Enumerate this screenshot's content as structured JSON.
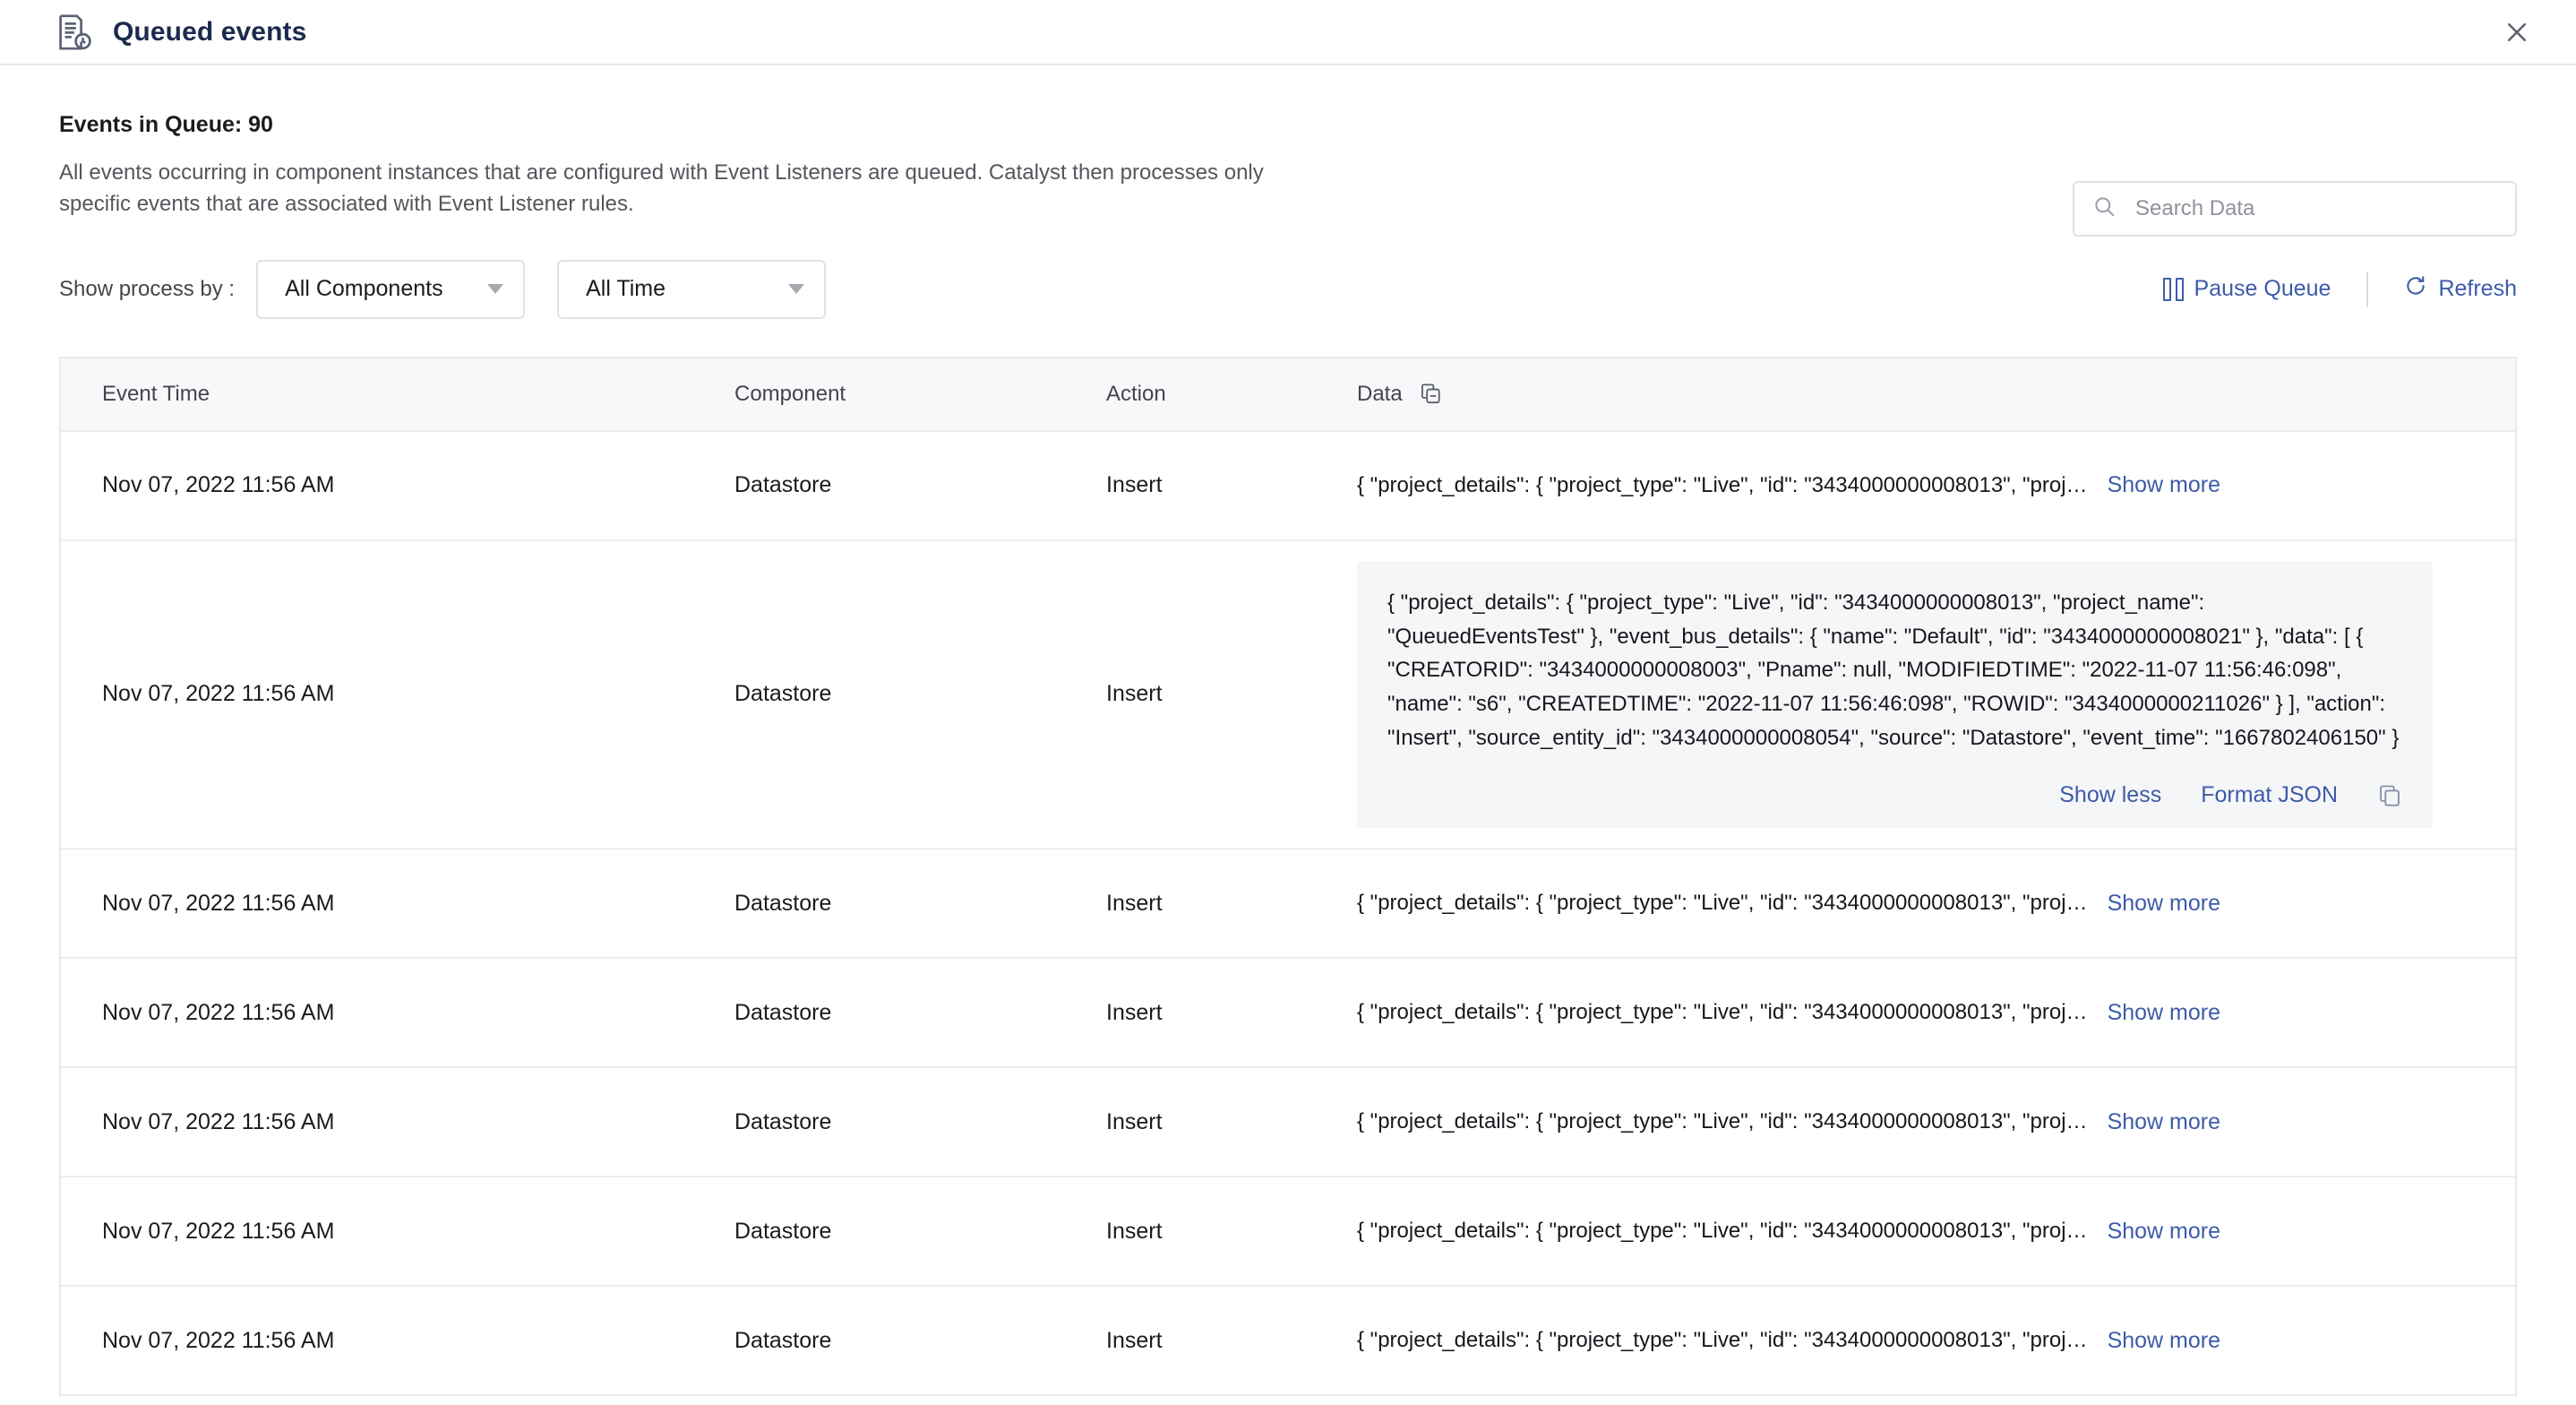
{
  "window": {
    "title": "Queued events",
    "title_icon": "document-clock-icon",
    "close_icon": "close-icon"
  },
  "summary": {
    "queue_count_label": "Events in Queue: 90",
    "description": "All events occurring in component instances that are configured with Event Listeners are queued. Catalyst then processes only specific events that are associated with Event Listener rules."
  },
  "search": {
    "placeholder": "Search Data",
    "value": "",
    "icon": "search-icon"
  },
  "filters": {
    "label": "Show process by :",
    "component_select": {
      "value": "All Components",
      "icon": "chevron-down-icon"
    },
    "time_select": {
      "value": "All Time",
      "icon": "chevron-down-icon"
    }
  },
  "actions": {
    "pause": {
      "label": "Pause Queue",
      "icon": "pause-icon"
    },
    "refresh": {
      "label": "Refresh",
      "icon": "refresh-icon"
    }
  },
  "table": {
    "columns": {
      "event_time": "Event Time",
      "component": "Component",
      "action": "Action",
      "data": "Data",
      "data_copy_icon": "copy-icon"
    },
    "truncated_json": "{ \"project_details\": { \"project_type\": \"Live\", \"id\": \"3434000000008013\", \"proj…",
    "show_more_label": "Show more",
    "rows": [
      {
        "event_time": "Nov 07, 2022 11:56 AM",
        "component": "Datastore",
        "action": "Insert",
        "expanded": false,
        "data_preview": "{ \"project_details\": { \"project_type\": \"Live\", \"id\": \"3434000000008013\", \"proj…"
      },
      {
        "event_time": "Nov 07, 2022 11:56 AM",
        "component": "Datastore",
        "action": "Insert",
        "expanded": true,
        "data_full": "{ \"project_details\": { \"project_type\": \"Live\", \"id\": \"3434000000008013\", \"project_name\": \"QueuedEventsTest\" }, \"event_bus_details\": { \"name\": \"Default\", \"id\": \"3434000000008021\" }, \"data\": [ { \"CREATORID\": \"3434000000008003\", \"Pname\": null, \"MODIFIEDTIME\": \"2022-11-07 11:56:46:098\", \"name\": \"s6\", \"CREATEDTIME\": \"2022-11-07 11:56:46:098\", \"ROWID\": \"3434000000211026\" } ], \"action\": \"Insert\", \"source_entity_id\": \"3434000000008054\", \"source\": \"Datastore\", \"event_time\": \"1667802406150\" }",
        "show_less_label": "Show less",
        "format_json_label": "Format JSON",
        "copy_icon": "copy-icon"
      },
      {
        "event_time": "Nov 07, 2022 11:56 AM",
        "component": "Datastore",
        "action": "Insert",
        "expanded": false,
        "data_preview": "{ \"project_details\": { \"project_type\": \"Live\", \"id\": \"3434000000008013\", \"proj…"
      },
      {
        "event_time": "Nov 07, 2022 11:56 AM",
        "component": "Datastore",
        "action": "Insert",
        "expanded": false,
        "data_preview": "{ \"project_details\": { \"project_type\": \"Live\", \"id\": \"3434000000008013\", \"proj…"
      },
      {
        "event_time": "Nov 07, 2022 11:56 AM",
        "component": "Datastore",
        "action": "Insert",
        "expanded": false,
        "data_preview": "{ \"project_details\": { \"project_type\": \"Live\", \"id\": \"3434000000008013\", \"proj…"
      },
      {
        "event_time": "Nov 07, 2022 11:56 AM",
        "component": "Datastore",
        "action": "Insert",
        "expanded": false,
        "data_preview": "{ \"project_details\": { \"project_type\": \"Live\", \"id\": \"3434000000008013\", \"proj…"
      },
      {
        "event_time": "Nov 07, 2022 11:56 AM",
        "component": "Datastore",
        "action": "Insert",
        "expanded": false,
        "data_preview": "{ \"project_details\": { \"project_type\": \"Live\", \"id\": \"3434000000008013\", \"proj…"
      }
    ]
  },
  "colors": {
    "link": "#3e5ba9",
    "title": "#1c2a4d",
    "header_bg": "#f7f8fa",
    "panel_bg": "#f5f6f7",
    "border": "#e9eaee"
  }
}
